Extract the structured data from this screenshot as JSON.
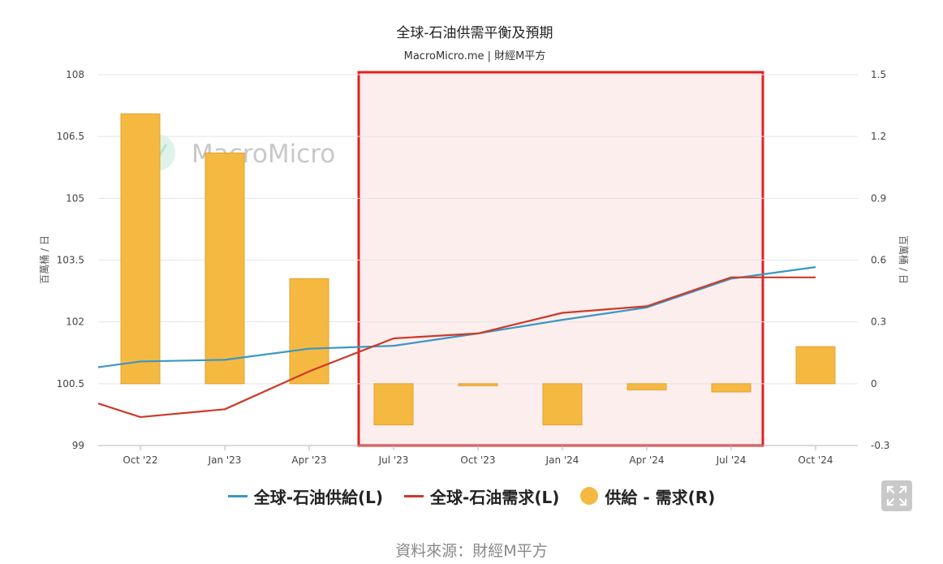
{
  "chart_data": {
    "type": "bar+line",
    "title": "全球-石油供需平衡及預期",
    "subtitle": "MacroMicro.me | 財經M平方",
    "watermark": "MacroMicro",
    "ylabel_left": "百萬桶 / 日",
    "ylabel_right": "百萬桶 / 日",
    "ylim_left": [
      99,
      108
    ],
    "ylim_right": [
      -0.3,
      1.5
    ],
    "yticks_left": [
      "108",
      "106.5",
      "105",
      "103.5",
      "102",
      "100.5",
      "99"
    ],
    "yticks_right": [
      "1.5",
      "1.2",
      "0.9",
      "0.6",
      "0.3",
      "0",
      "-0.3"
    ],
    "categories": [
      "Oct '22",
      "Jan '23",
      "Apr '23",
      "Jul '23",
      "Oct '23",
      "Jan '24",
      "Apr '24",
      "Jul '24",
      "Oct '24"
    ],
    "series": [
      {
        "name": "全球-石油供給(L)",
        "type": "line",
        "axis": "left",
        "color": "#3a97c4",
        "values": [
          101.04,
          101.08,
          101.35,
          101.42,
          101.72,
          102.05,
          102.35,
          103.05,
          103.33
        ]
      },
      {
        "name": "全球-石油需求(L)",
        "type": "line",
        "axis": "left",
        "color": "#cc3a28",
        "values": [
          99.69,
          99.88,
          100.8,
          101.6,
          101.72,
          102.22,
          102.38,
          103.08,
          103.08
        ]
      },
      {
        "name": "供給 - 需求(R)",
        "type": "bar",
        "axis": "right",
        "color": "#f5b942",
        "values": [
          1.31,
          1.12,
          0.51,
          -0.2,
          -0.01,
          -0.2,
          -0.03,
          -0.04,
          0.18
        ]
      }
    ],
    "line_start_left": {
      "supply": 100.9,
      "demand": 100.02
    },
    "highlight": {
      "from": "Jul '23",
      "to": "Jul '24",
      "border_color": "#e02020",
      "fill_color": "#fdeeee"
    },
    "grid": true,
    "legend_position": "bottom-center"
  },
  "legend": [
    {
      "label": "全球-石油供給(L)",
      "color": "#3a97c4",
      "shape": "line"
    },
    {
      "label": "全球-石油需求(L)",
      "color": "#cc3a28",
      "shape": "line"
    },
    {
      "label": "供給 - 需求(R)",
      "color": "#f5b942",
      "shape": "dot"
    }
  ],
  "expand_icon": "expand-arrows-icon",
  "source": "資料來源：財經M平方"
}
